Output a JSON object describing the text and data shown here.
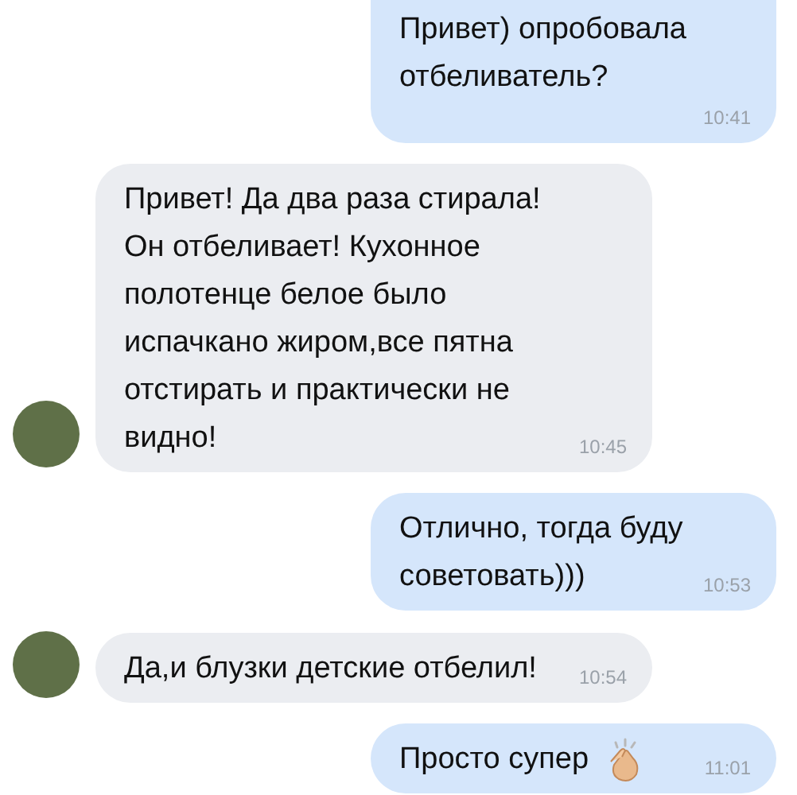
{
  "messages": [
    {
      "kind": "outgoing",
      "text": "Привет) опробовала\nотбеливатель?",
      "time": "10:41"
    },
    {
      "kind": "incoming",
      "text": "Привет! Да два раза стирала!\nОн отбеливает! Кухонное\nполотенце белое было\nиспачкано жиром,все пятна\nотстирать и практически не\nвидно!",
      "time": "10:45",
      "avatar": true
    },
    {
      "kind": "outgoing",
      "text": "Отлично, тогда буду\nсоветовать)))",
      "time": "10:53"
    },
    {
      "kind": "incoming",
      "text": "Да,и блузки детские отбелил!",
      "time": "10:54",
      "avatar": true
    },
    {
      "kind": "outgoing",
      "text": "Просто супер",
      "time": "11:01",
      "has_icon": true
    }
  ]
}
